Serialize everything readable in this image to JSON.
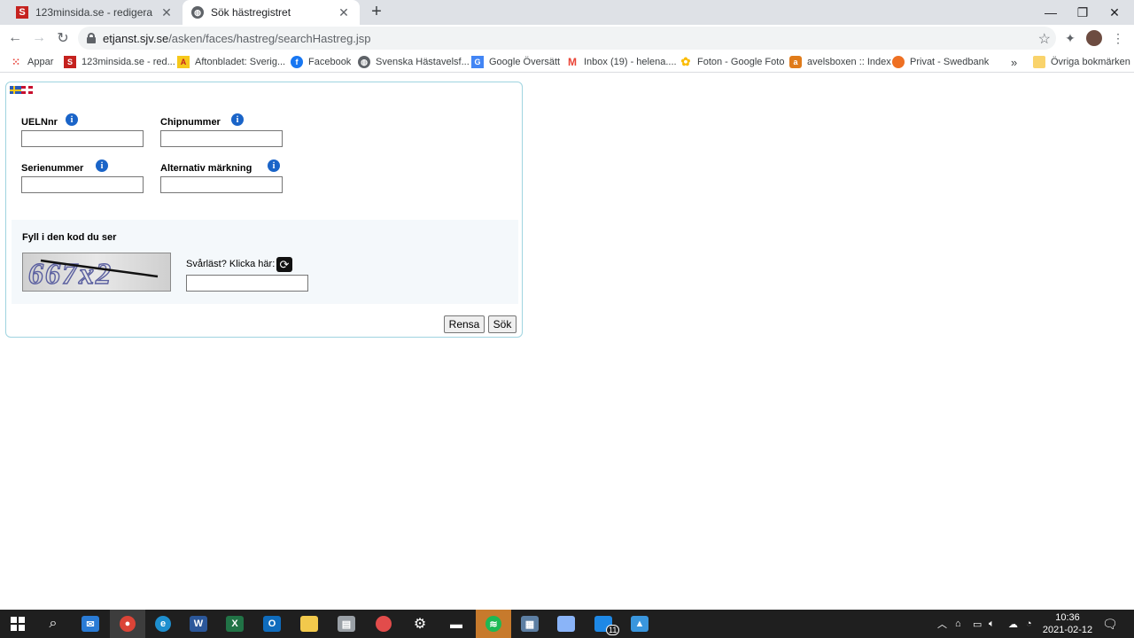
{
  "browser": {
    "tabs": [
      {
        "title": "123minsida.se - redigera",
        "favicon": "s-logo-icon"
      },
      {
        "title": "Sök hästregistret",
        "favicon": "globe-icon"
      }
    ],
    "url_host": "etjanst.sjv.se",
    "url_path": "/asken/faces/hastreg/searchHastreg.jsp",
    "bookmarks": [
      {
        "label": "Appar",
        "icon": "apps-grid-icon"
      },
      {
        "label": "123minsida.se - red...",
        "icon": "s-logo-icon"
      },
      {
        "label": "Aftonbladet: Sverig...",
        "icon": "aftonbladet-icon"
      },
      {
        "label": "Facebook",
        "icon": "facebook-icon"
      },
      {
        "label": "Svenska Hästavelsf...",
        "icon": "globe-icon"
      },
      {
        "label": "Google Översätt",
        "icon": "google-translate-icon"
      },
      {
        "label": "Inbox (19) - helena....",
        "icon": "gmail-icon"
      },
      {
        "label": "Foton - Google Foto",
        "icon": "google-photos-icon"
      },
      {
        "label": "avelsboxen :: Index",
        "icon": "avelsboxen-icon"
      },
      {
        "label": "Privat - Swedbank",
        "icon": "swedbank-icon"
      }
    ],
    "more_bookmarks": "»",
    "other_bookmarks": "Övriga bokmärken"
  },
  "form": {
    "uelnnr_label": "UELNnr",
    "chip_label": "Chipnummer",
    "serie_label": "Serienummer",
    "alt_label": "Alternativ märkning",
    "captcha_title": "Fyll i den kod du ser",
    "captcha_text": "667x2",
    "captcha_help": "Svårläst? Klicka här:",
    "clear_button": "Rensa",
    "search_button": "Sök"
  },
  "taskbar": {
    "time": "10:36",
    "date": "2021-02-12",
    "badge": "11"
  },
  "colors": {
    "panel_border": "#9fd4e0",
    "captcha_bg": "#f4f8fb",
    "info_icon": "#1a64c8"
  }
}
